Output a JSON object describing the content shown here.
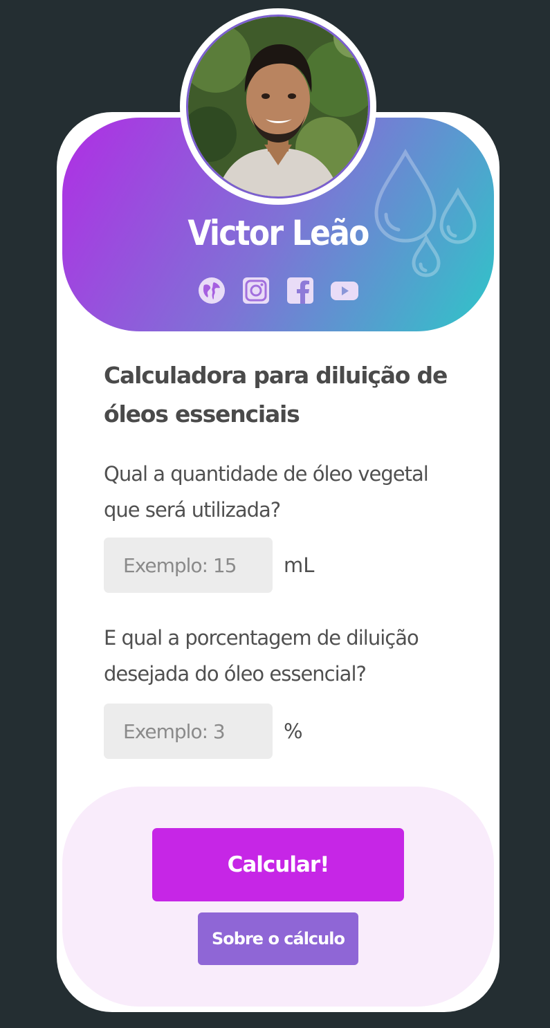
{
  "profile": {
    "name": "Victor Leão",
    "avatar_alt": "Victor Leão",
    "socials": [
      {
        "icon": "globe-icon"
      },
      {
        "icon": "instagram-icon"
      },
      {
        "icon": "facebook-icon"
      },
      {
        "icon": "youtube-icon"
      }
    ]
  },
  "calculator": {
    "title": "Calculadora para diluição de óleos essenciais",
    "question_oil": "Qual a quantidade de óleo vegetal que será utilizada?",
    "oil_input": {
      "placeholder": "Exemplo: 15",
      "value": "",
      "unit": "mL"
    },
    "question_percent": "E qual a porcentagem de diluição desejada do óleo essencial?",
    "percent_input": {
      "placeholder": "Exemplo: 3",
      "value": "",
      "unit": "%"
    }
  },
  "actions": {
    "calculate_label": "Calcular!",
    "about_label": "Sobre o cálculo"
  },
  "colors": {
    "background": "#242e32",
    "gradient_start": "#b02ee4",
    "gradient_end": "#2ec6c8",
    "calculate_button": "#c626e6",
    "about_button": "#8f66d6",
    "footer_panel": "#f9ecfb"
  }
}
